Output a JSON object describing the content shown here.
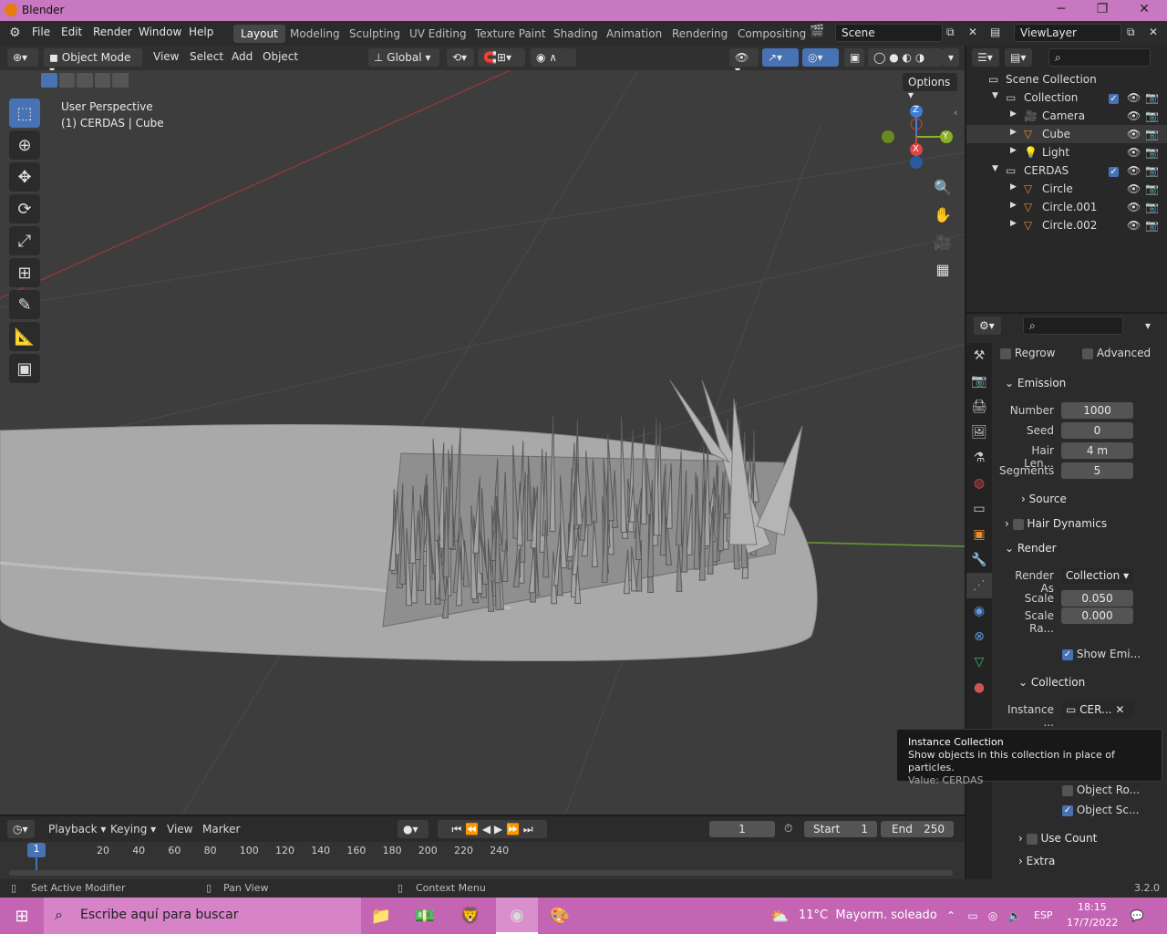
{
  "titlebar": {
    "title": "Blender"
  },
  "menus": [
    "File",
    "Edit",
    "Render",
    "Window",
    "Help"
  ],
  "workspaces": [
    "Layout",
    "Modeling",
    "Sculpting",
    "UV Editing",
    "Texture Paint",
    "Shading",
    "Animation",
    "Rendering",
    "Compositing"
  ],
  "scene": "Scene",
  "view_layer": "ViewLayer",
  "header": {
    "mode": "Object Mode",
    "menus": [
      "View",
      "Select",
      "Add",
      "Object"
    ],
    "orientation": "Global",
    "options": "Options"
  },
  "viewport": {
    "perspective": "User Perspective",
    "object_info": "(1) CERDAS | Cube"
  },
  "gizmo": {
    "x": "X",
    "y": "Y",
    "z": "Z"
  },
  "outliner": {
    "root": "Scene Collection",
    "items": [
      {
        "name": "Collection",
        "level": 1
      },
      {
        "name": "Camera",
        "level": 2
      },
      {
        "name": "Cube",
        "level": 2
      },
      {
        "name": "Light",
        "level": 2
      },
      {
        "name": "CERDAS",
        "level": 1
      },
      {
        "name": "Circle",
        "level": 2
      },
      {
        "name": "Circle.001",
        "level": 2
      },
      {
        "name": "Circle.002",
        "level": 2
      }
    ]
  },
  "properties": {
    "regrow": "Regrow",
    "advanced": "Advanced",
    "emission": "Emission",
    "number_label": "Number",
    "number": "1000",
    "seed_label": "Seed",
    "seed": "0",
    "hair_len_label": "Hair Len...",
    "hair_len": "4 m",
    "segments_label": "Segments",
    "segments": "5",
    "source": "Source",
    "hair_dynamics": "Hair Dynamics",
    "render": "Render",
    "render_as_label": "Render As",
    "render_as": "Collection",
    "scale_label": "Scale",
    "scale": "0.050",
    "scale_ra_label": "Scale Ra...",
    "scale_ra": "0.000",
    "show_emitter": "Show Emi...",
    "collection": "Collection",
    "instance_label": "Instance ...",
    "instance": "CER...",
    "object_ro": "Object Ro...",
    "object_sc": "Object Sc...",
    "use_count": "Use Count",
    "extra": "Extra"
  },
  "tooltip": {
    "title": "Instance Collection",
    "desc": "Show objects in this collection in place of particles.",
    "value": "Value: CERDAS"
  },
  "timeline": {
    "menus": [
      "Playback",
      "Keying",
      "View",
      "Marker"
    ],
    "current": "1",
    "start_label": "Start",
    "start": "1",
    "end_label": "End",
    "end": "250",
    "ticks": [
      "20",
      "40",
      "60",
      "80",
      "100",
      "120",
      "140",
      "160",
      "180",
      "200",
      "220",
      "240"
    ],
    "cursor": "1"
  },
  "statusbar": {
    "left": "Set Active Modifier",
    "mid": "Pan View",
    "right": "Context Menu",
    "version": "3.2.0"
  },
  "taskbar": {
    "search": "Escribe aquí para buscar",
    "weather": "11°C  Mayorm. soleado",
    "lang": "ESP",
    "time": "18:15",
    "date": "17/7/2022"
  }
}
